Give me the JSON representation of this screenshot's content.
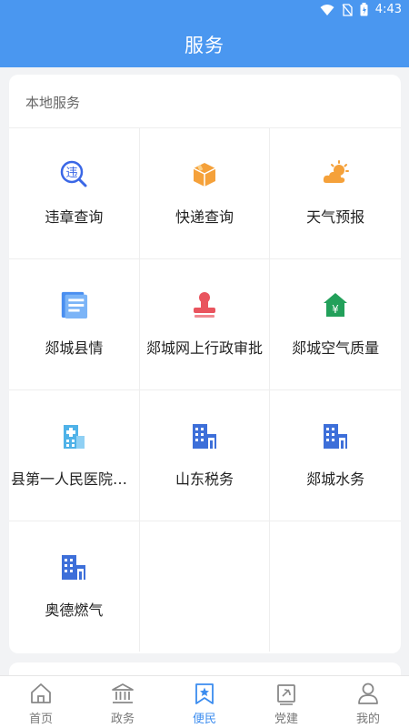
{
  "status_bar": {
    "time": "4:43"
  },
  "header": {
    "title": "服务"
  },
  "section": {
    "title": "本地服务"
  },
  "services": [
    {
      "label": "违章查询",
      "icon": "violation-search-icon"
    },
    {
      "label": "快递查询",
      "icon": "package-icon"
    },
    {
      "label": "天气预报",
      "icon": "weather-icon"
    },
    {
      "label": "郯城县情",
      "icon": "document-icon"
    },
    {
      "label": "郯城网上行政审批",
      "icon": "stamp-icon"
    },
    {
      "label": "郯城空气质量",
      "icon": "house-yuan-icon"
    },
    {
      "label": "县第一人民医院出...",
      "icon": "hospital-icon"
    },
    {
      "label": "山东税务",
      "icon": "building-icon"
    },
    {
      "label": "郯城水务",
      "icon": "building-icon"
    },
    {
      "label": "奥德燃气",
      "icon": "building-icon"
    }
  ],
  "tabs": [
    {
      "label": "首页",
      "icon": "home-icon"
    },
    {
      "label": "政务",
      "icon": "government-icon"
    },
    {
      "label": "便民",
      "icon": "bookmark-star-icon",
      "active": true
    },
    {
      "label": "党建",
      "icon": "party-flag-icon"
    },
    {
      "label": "我的",
      "icon": "user-icon"
    }
  ],
  "colors": {
    "primary": "#4a97f0",
    "active_tab": "#3b8cef",
    "building": "#3d6fd9",
    "orange": "#f5a13a",
    "red": "#e9545e",
    "green": "#22a05a"
  }
}
